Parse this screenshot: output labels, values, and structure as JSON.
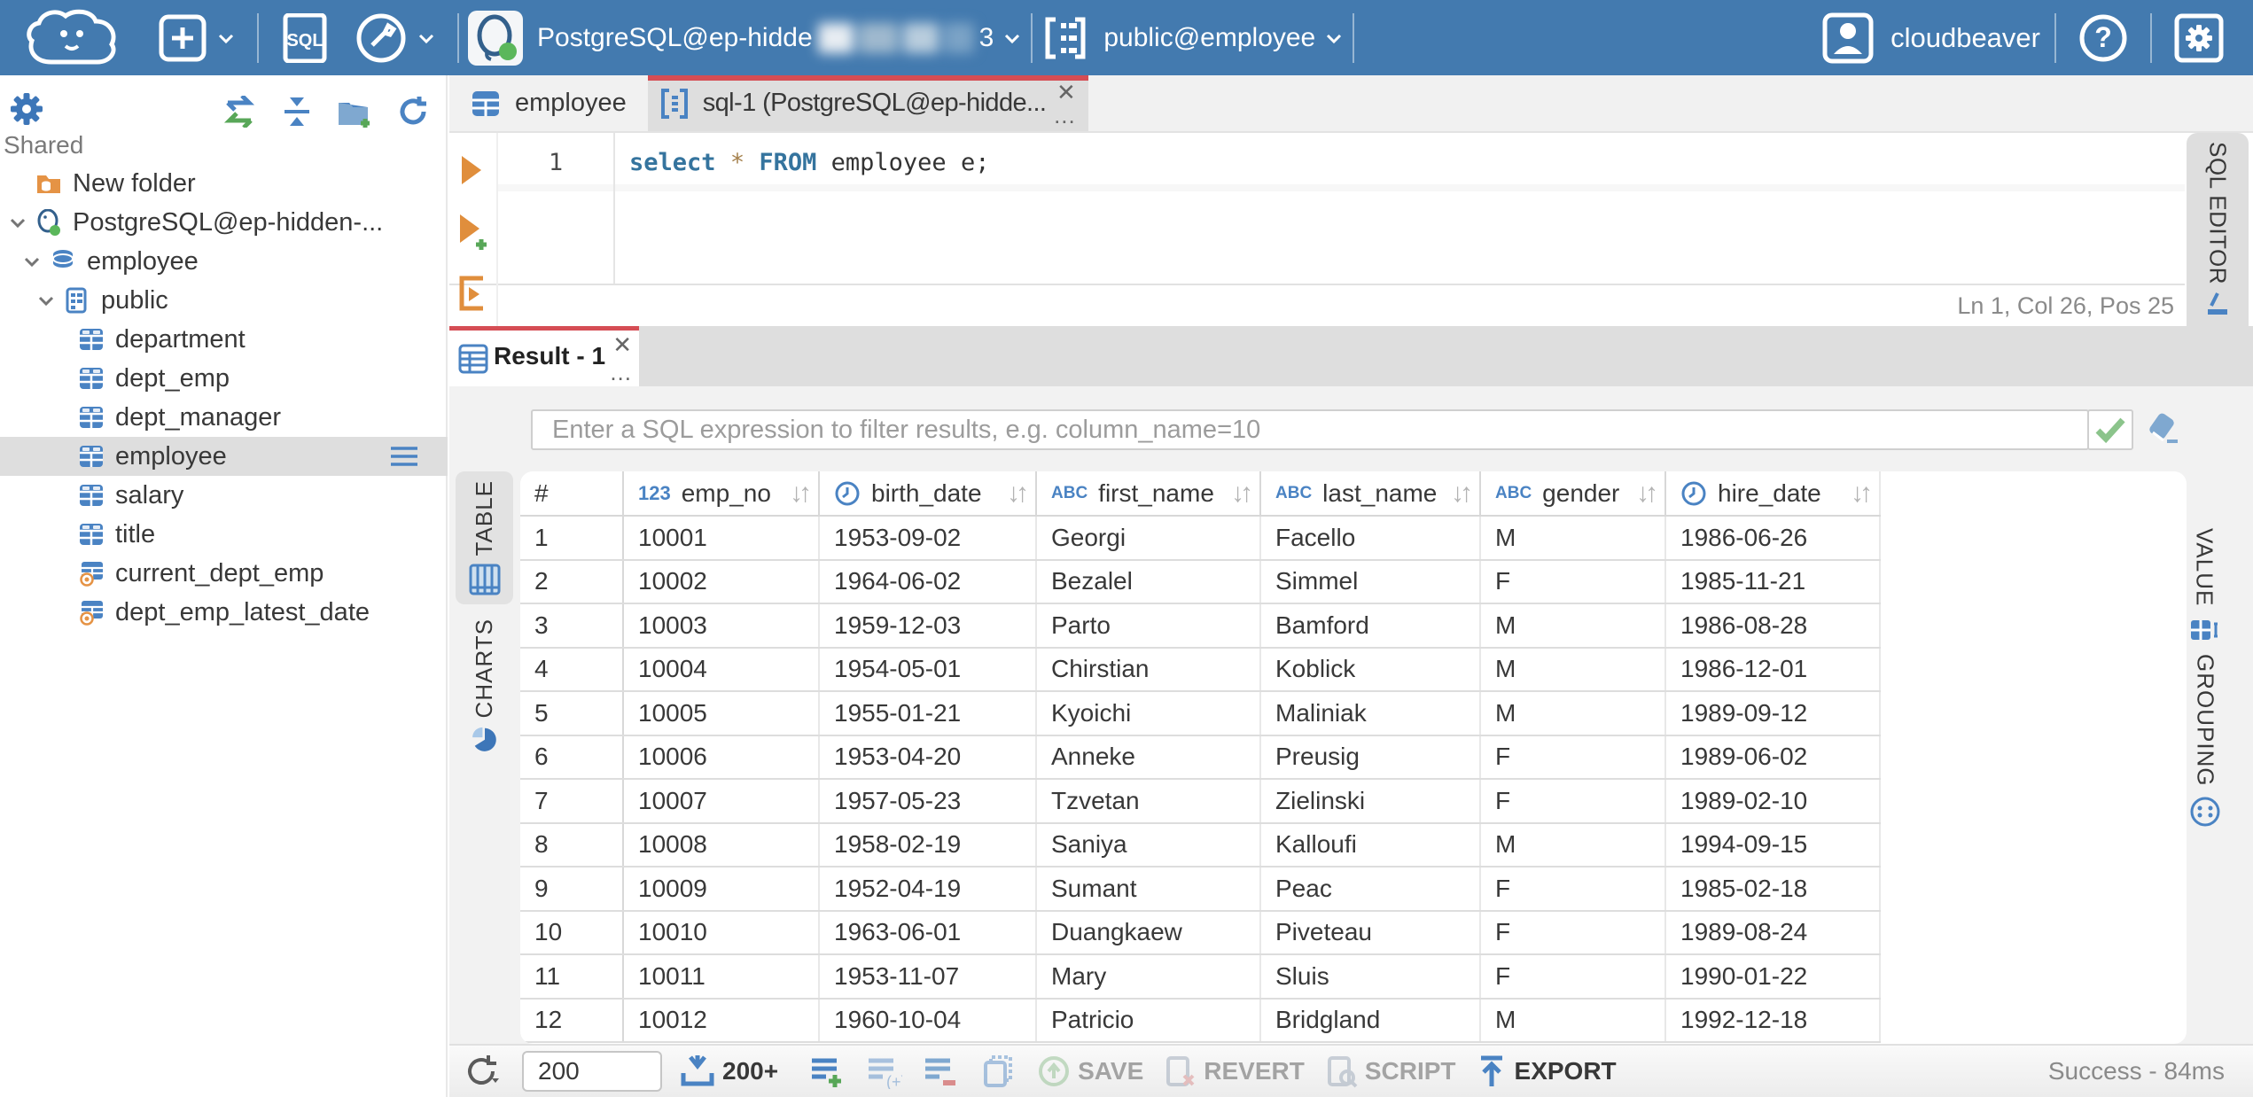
{
  "topbar": {
    "connection": {
      "label": "PostgreSQL@ep-hidde",
      "masked_tail": "3"
    },
    "schema": {
      "label": "public@employee"
    },
    "user": {
      "label": "cloudbeaver"
    }
  },
  "sidebar": {
    "section_label": "Shared",
    "tree": [
      {
        "label": "New folder",
        "depth": 0,
        "icon": "folder",
        "chevron": false,
        "selected": false
      },
      {
        "label": "PostgreSQL@ep-hidden-...",
        "depth": 0,
        "icon": "postgres",
        "chevron": true,
        "selected": false
      },
      {
        "label": "employee",
        "depth": 1,
        "icon": "database",
        "chevron": true,
        "selected": false
      },
      {
        "label": "public",
        "depth": 2,
        "icon": "schema",
        "chevron": true,
        "selected": false
      },
      {
        "label": "department",
        "depth": 3,
        "icon": "table",
        "chevron": false,
        "selected": false
      },
      {
        "label": "dept_emp",
        "depth": 3,
        "icon": "table",
        "chevron": false,
        "selected": false
      },
      {
        "label": "dept_manager",
        "depth": 3,
        "icon": "table",
        "chevron": false,
        "selected": false
      },
      {
        "label": "employee",
        "depth": 3,
        "icon": "table",
        "chevron": false,
        "selected": true
      },
      {
        "label": "salary",
        "depth": 3,
        "icon": "table",
        "chevron": false,
        "selected": false
      },
      {
        "label": "title",
        "depth": 3,
        "icon": "table",
        "chevron": false,
        "selected": false
      },
      {
        "label": "current_dept_emp",
        "depth": 3,
        "icon": "view",
        "chevron": false,
        "selected": false
      },
      {
        "label": "dept_emp_latest_date",
        "depth": 3,
        "icon": "view",
        "chevron": false,
        "selected": false
      }
    ]
  },
  "editor": {
    "tabs": [
      {
        "label": "employee",
        "icon": "table",
        "active": false
      },
      {
        "label": "sql-1 (PostgreSQL@ep-hidde...",
        "icon": "script",
        "active": true
      }
    ],
    "line_number": "1",
    "code": {
      "kw1": "select",
      "star": "*",
      "kw2": "FROM",
      "rest": "employee e;"
    },
    "status": "Ln 1, Col 26, Pos 25",
    "right_tab": "SQL EDITOR"
  },
  "result": {
    "tab_label": "Result - 1",
    "filter_placeholder": "Enter a SQL expression to filter results, e.g. column_name=10",
    "left_tabs": [
      {
        "label": "TABLE"
      },
      {
        "label": "CHARTS"
      }
    ],
    "right_tabs": [
      {
        "label": "VALUE"
      },
      {
        "label": "GROUPING"
      }
    ],
    "table": {
      "columns": [
        {
          "label": "#",
          "type": "none"
        },
        {
          "label": "emp_no",
          "type": "num"
        },
        {
          "label": "birth_date",
          "type": "date"
        },
        {
          "label": "first_name",
          "type": "str"
        },
        {
          "label": "last_name",
          "type": "str"
        },
        {
          "label": "gender",
          "type": "str"
        },
        {
          "label": "hire_date",
          "type": "date"
        }
      ],
      "rows": [
        [
          "1",
          "10001",
          "1953-09-02",
          "Georgi",
          "Facello",
          "M",
          "1986-06-26"
        ],
        [
          "2",
          "10002",
          "1964-06-02",
          "Bezalel",
          "Simmel",
          "F",
          "1985-11-21"
        ],
        [
          "3",
          "10003",
          "1959-12-03",
          "Parto",
          "Bamford",
          "M",
          "1986-08-28"
        ],
        [
          "4",
          "10004",
          "1954-05-01",
          "Chirstian",
          "Koblick",
          "M",
          "1986-12-01"
        ],
        [
          "5",
          "10005",
          "1955-01-21",
          "Kyoichi",
          "Maliniak",
          "M",
          "1989-09-12"
        ],
        [
          "6",
          "10006",
          "1953-04-20",
          "Anneke",
          "Preusig",
          "F",
          "1989-06-02"
        ],
        [
          "7",
          "10007",
          "1957-05-23",
          "Tzvetan",
          "Zielinski",
          "F",
          "1989-02-10"
        ],
        [
          "8",
          "10008",
          "1958-02-19",
          "Saniya",
          "Kalloufi",
          "M",
          "1994-09-15"
        ],
        [
          "9",
          "10009",
          "1952-04-19",
          "Sumant",
          "Peac",
          "F",
          "1985-02-18"
        ],
        [
          "10",
          "10010",
          "1963-06-01",
          "Duangkaew",
          "Piveteau",
          "F",
          "1989-08-24"
        ],
        [
          "11",
          "10011",
          "1953-11-07",
          "Mary",
          "Sluis",
          "F",
          "1990-01-22"
        ],
        [
          "12",
          "10012",
          "1960-10-04",
          "Patricio",
          "Bridgland",
          "M",
          "1992-12-18"
        ]
      ]
    },
    "toolbar": {
      "fetch_size": "200",
      "fetch_more": "200+",
      "save": "SAVE",
      "revert": "REVERT",
      "script": "SCRIPT",
      "export": "EXPORT",
      "status": "Success - 84ms"
    }
  },
  "colors": {
    "topbar": "#437AAF",
    "accent_red": "#D54D54",
    "icon_blue": "#4A83C3",
    "icon_orange": "#E08E3C"
  }
}
